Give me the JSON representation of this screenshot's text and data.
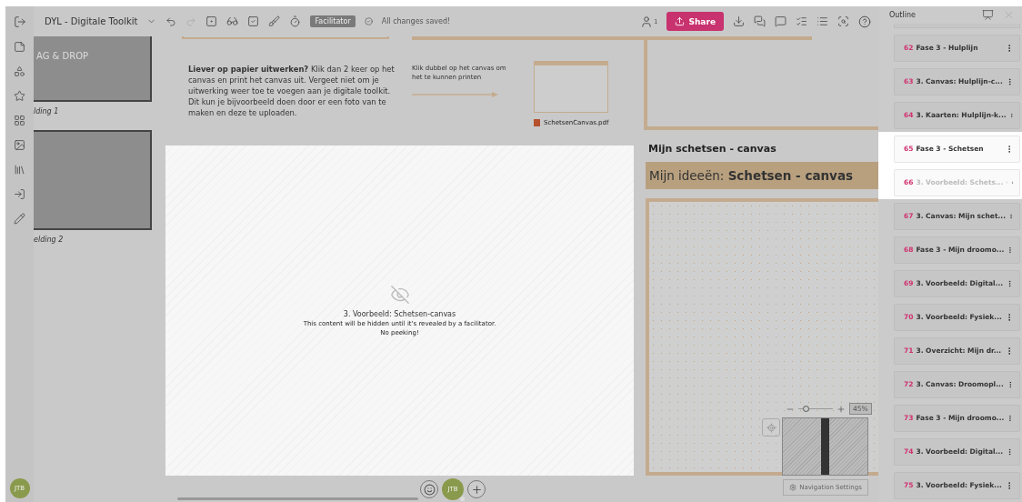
{
  "toolbar": {
    "board_title": "DYL - Digitale Toolkit",
    "role_badge": "Facilitator",
    "save_status": "All changes saved!",
    "participants_count": "1",
    "share_label": "Share"
  },
  "left_rail": {
    "avatar": "JTB"
  },
  "thumbnails": [
    {
      "title": "AG & DROP",
      "caption": "lding 1"
    },
    {
      "caption": "elding 2"
    }
  ],
  "canvas": {
    "note_paragraph": "**Liever op papier uitwerken?** Klik dan 2 keer op het canvas en print het canvas uit. Vergeet niet om je uitwerking weer toe te voegen aan je digitale toolkit. Dit kun je bijvoorbeeld doen door er een foto van te maken en deze te uploaden.",
    "arrow_hint": "Klik dubbel op het canvas om het te kunnen printen",
    "attachment": "SchetsenCanvas.pdf",
    "hidden_frame": {
      "title": "3. Voorbeeld: Schetsen-canvas",
      "message": "This content will be hidden until it's revealed by a facilitator.",
      "submessage": "No peeking!"
    },
    "frame_title": "Mijn schetsen - canvas",
    "banner": "Mijn ideeën: **Schetsen - canvas**",
    "zoom": {
      "level": 0.2,
      "reading": "45%"
    },
    "navigation_settings": "Navigation Settings"
  },
  "bottom_bar": {
    "avatar": "JTB"
  },
  "outline": {
    "title": "Outline",
    "items": [
      {
        "number": "62",
        "title": "Fase 3 - Hulplijn",
        "selected": false,
        "hidden": false
      },
      {
        "number": "63",
        "title": "3. Canvas: Hulplijn-c...",
        "selected": false,
        "hidden": false
      },
      {
        "number": "64",
        "title": "3. Kaarten: Hulplijn-k...",
        "selected": false,
        "hidden": false
      },
      {
        "number": "65",
        "title": "Fase 3 - Schetsen",
        "selected": true,
        "hidden": false
      },
      {
        "number": "66",
        "title": "3. Voorbeeld: Schets...",
        "selected": true,
        "hidden": true
      },
      {
        "number": "67",
        "title": "3. Canvas: Mijn schet...",
        "selected": false,
        "hidden": false
      },
      {
        "number": "68",
        "title": "Fase 3 - Mijn droomo...",
        "selected": false,
        "hidden": false
      },
      {
        "number": "69",
        "title": "3. Voorbeeld: Digital...",
        "selected": false,
        "hidden": false
      },
      {
        "number": "70",
        "title": "3. Voorbeeld: Fysiek...",
        "selected": false,
        "hidden": false
      },
      {
        "number": "71",
        "title": "3. Overzicht: Mijn dr...",
        "selected": false,
        "hidden": false
      },
      {
        "number": "72",
        "title": "3. Canvas: Droomopl...",
        "selected": false,
        "hidden": false
      },
      {
        "number": "73",
        "title": "Fase 3 - Mijn droomo...",
        "selected": false,
        "hidden": false
      },
      {
        "number": "74",
        "title": "3. Voorbeeld: Digital...",
        "selected": false,
        "hidden": false
      },
      {
        "number": "75",
        "title": "3. Voorbeeld: Fysiek...",
        "selected": false,
        "hidden": false
      }
    ]
  }
}
